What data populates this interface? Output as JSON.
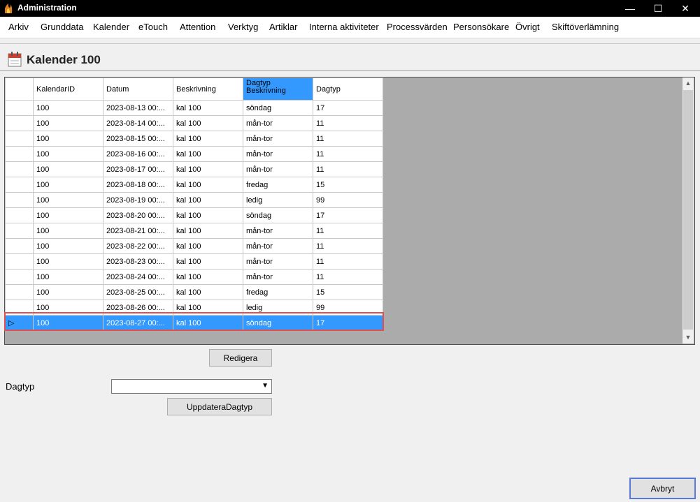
{
  "window": {
    "title": "Administration",
    "icon": "app-flame-icon",
    "controls": [
      "minimize-icon",
      "maximize-icon",
      "close-icon"
    ]
  },
  "menu": [
    "Arkiv",
    "Grunddata",
    "Kalender",
    "eTouch",
    "Attention",
    "Verktyg",
    "Artiklar",
    "Interna aktiviteter",
    "Processvärden",
    "Personsökare",
    "Övrigt",
    "Skiftöverlämning"
  ],
  "page": {
    "title": "Kalender 100",
    "icon": "calendar-icon"
  },
  "grid": {
    "columns": [
      "KalendarID",
      "Datum",
      "Beskrivning",
      "Dagtyp Beskrivning",
      "Dagtyp"
    ],
    "rows": [
      [
        "100",
        "2023-08-13 00:...",
        "kal 100",
        "söndag",
        "17"
      ],
      [
        "100",
        "2023-08-14 00:...",
        "kal 100",
        "mån-tor",
        "11"
      ],
      [
        "100",
        "2023-08-15 00:...",
        "kal 100",
        "mån-tor",
        "11"
      ],
      [
        "100",
        "2023-08-16 00:...",
        "kal 100",
        "mån-tor",
        "11"
      ],
      [
        "100",
        "2023-08-17 00:...",
        "kal 100",
        "mån-tor",
        "11"
      ],
      [
        "100",
        "2023-08-18 00:...",
        "kal 100",
        "fredag",
        "15"
      ],
      [
        "100",
        "2023-08-19 00:...",
        "kal 100",
        "ledig",
        "99"
      ],
      [
        "100",
        "2023-08-20 00:...",
        "kal 100",
        "söndag",
        "17"
      ],
      [
        "100",
        "2023-08-21 00:...",
        "kal 100",
        "mån-tor",
        "11"
      ],
      [
        "100",
        "2023-08-22 00:...",
        "kal 100",
        "mån-tor",
        "11"
      ],
      [
        "100",
        "2023-08-23 00:...",
        "kal 100",
        "mån-tor",
        "11"
      ],
      [
        "100",
        "2023-08-24 00:...",
        "kal 100",
        "mån-tor",
        "11"
      ],
      [
        "100",
        "2023-08-25 00:...",
        "kal 100",
        "fredag",
        "15"
      ],
      [
        "100",
        "2023-08-26 00:...",
        "kal 100",
        "ledig",
        "99"
      ],
      [
        "100",
        "2023-08-27 00:...",
        "kal 100",
        "söndag",
        "17"
      ]
    ],
    "selected_row": 14,
    "selected_column": 3
  },
  "buttons": {
    "edit": "Redigera",
    "update": "UppdateraDagtyp",
    "cancel": "Avbryt"
  },
  "dagtyp": {
    "label": "Dagtyp",
    "value": ""
  }
}
